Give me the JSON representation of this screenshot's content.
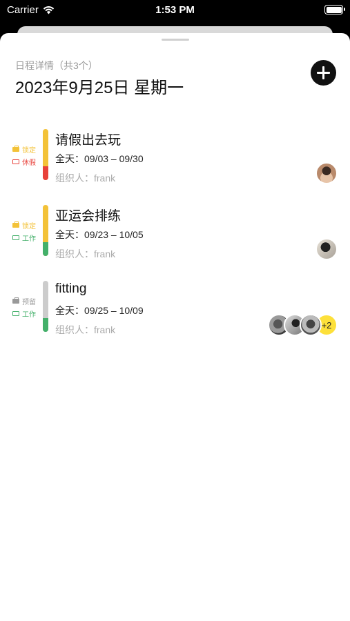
{
  "status": {
    "carrier": "Carrier",
    "time": "1:53 PM"
  },
  "sheet": {
    "subtitle": "日程详情（共3个）",
    "title": "2023年9月25日 星期一",
    "add_icon": "plus-circle-icon"
  },
  "events": [
    {
      "title": "请假出去玩",
      "date": "全天：09/03 – 09/30",
      "organizer": "组织人：frank",
      "tags": [
        {
          "label": "锁定",
          "color": "#f3c238",
          "icon": "briefcase-icon"
        },
        {
          "label": "休假",
          "color": "#e8413a",
          "icon": "suitcase-icon"
        }
      ],
      "bar_color": "#f3c238",
      "bar_bottom_color": "#e8413a",
      "avatars": [
        "avatar-1"
      ],
      "more": ""
    },
    {
      "title": "亚运会排练",
      "date": "全天：09/23 – 10/05",
      "organizer": "组织人：frank",
      "tags": [
        {
          "label": "锁定",
          "color": "#f3c238",
          "icon": "briefcase-icon"
        },
        {
          "label": "工作",
          "color": "#43b06a",
          "icon": "work-bag-icon"
        }
      ],
      "bar_color": "#f3c238",
      "bar_bottom_color": "#43b06a",
      "avatars": [
        "avatar-2"
      ],
      "more": ""
    },
    {
      "title": "fitting",
      "date": "全天：09/25 – 10/09",
      "organizer": "组织人：frank",
      "tags": [
        {
          "label": "预留",
          "color": "#999999",
          "icon": "lock-icon"
        },
        {
          "label": "工作",
          "color": "#43b06a",
          "icon": "work-bag-icon"
        }
      ],
      "bar_color": "#cccccc",
      "bar_bottom_color": "#43b06a",
      "avatars": [
        "avatar-3",
        "avatar-4",
        "avatar-5"
      ],
      "more": "+2"
    }
  ]
}
